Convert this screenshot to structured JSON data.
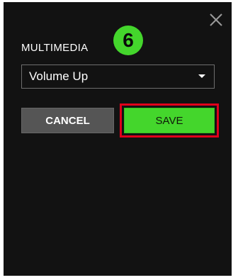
{
  "dialog": {
    "title": "MULTIMEDIA",
    "step_badge": "6",
    "select": {
      "value": "Volume Up"
    },
    "buttons": {
      "cancel": "CANCEL",
      "save": "SAVE"
    },
    "colors": {
      "accent_green": "#44d62c",
      "highlight_red": "#e0001b",
      "panel_bg": "#121212",
      "cancel_bg": "#555555"
    },
    "icons": {
      "close": "close-icon",
      "caret": "chevron-down-icon"
    }
  }
}
